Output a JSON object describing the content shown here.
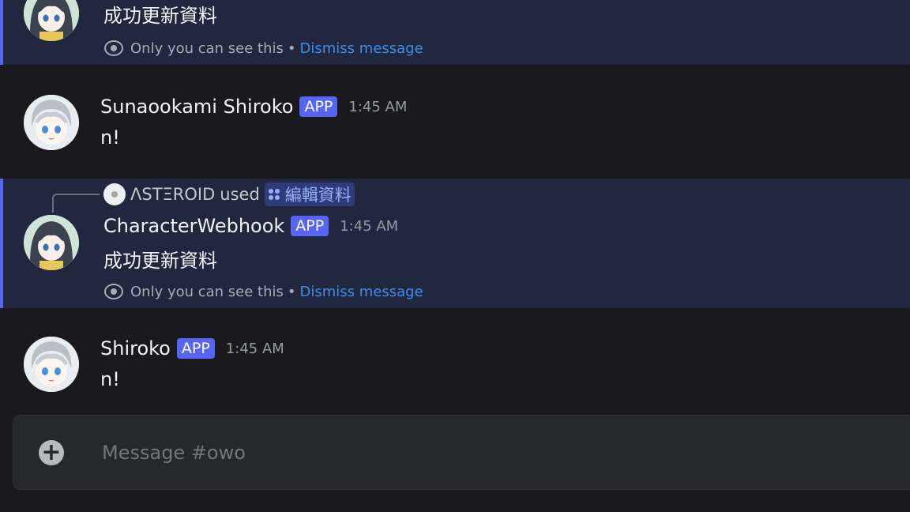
{
  "messages": [
    {
      "id": "m1",
      "ephemeral": true,
      "content": "成功更新資料",
      "notice": {
        "text": "Only you can see this",
        "separator": "•",
        "dismiss": "Dismiss message"
      }
    },
    {
      "id": "m2",
      "username": "Sunaookami Shiroko",
      "badge": "APP",
      "time": "1:45 AM",
      "content": "n!"
    },
    {
      "id": "m3",
      "ephemeral": true,
      "reply": {
        "user": "ΛSTΞROID",
        "used": "used",
        "command": "編輯資料"
      },
      "username": "CharacterWebhook",
      "badge": "APP",
      "time": "1:45 AM",
      "content": "成功更新資料",
      "notice": {
        "text": "Only you can see this",
        "separator": "•",
        "dismiss": "Dismiss message"
      }
    },
    {
      "id": "m4",
      "username": "Shiroko",
      "badge": "APP",
      "time": "1:45 AM",
      "content": "n!"
    }
  ],
  "composer": {
    "placeholder": "Message #owo",
    "add_icon": "plus-circle-icon"
  },
  "colors": {
    "background": "#1a1a1e",
    "ephemeral_bg": "#222740",
    "accent": "#5865f2",
    "link": "#3d8ee8"
  }
}
